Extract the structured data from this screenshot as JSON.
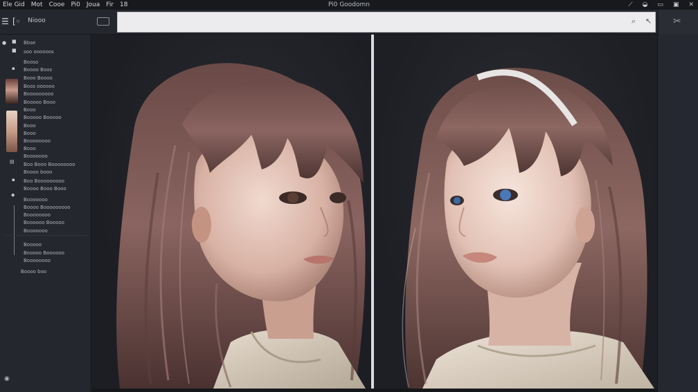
{
  "menubar": {
    "menus": [
      "Ele Gid",
      "Mot",
      "Cooe",
      "Pi0",
      "Joua",
      "Fir",
      "18"
    ],
    "title": "Pi0 Goodomn",
    "window_icons": [
      "pin-icon",
      "eye-icon",
      "window-icon",
      "window-icon",
      "close-icon"
    ]
  },
  "toolbar": {
    "label": "Niooo",
    "search": {
      "value": "",
      "placeholder": ""
    },
    "icons": [
      "menu-icon",
      "code-icon",
      "search-icon",
      "arrow-icon",
      "tools-icon"
    ]
  },
  "leftpanel": {
    "items": [
      "Bbse",
      "soo oooooos",
      "Booso",
      "Boooo Boos",
      "Booo Boooo",
      "Boos oooooo",
      "Booooooooo",
      "Booooo Booo",
      "Booo",
      "Booooo Booooo",
      "Booo",
      "Booo",
      "Boooooooo",
      "Booo",
      "Booooooo",
      "Boo Booo Boooooooo",
      "Boooo booo",
      "Boo Booooooooo",
      "Boooo Booo Booo",
      "Booooooo",
      "Boooo Booooooooo",
      "Boooooooo",
      "Boooooo Booooo",
      "Booooooo",
      "Booooo",
      "Booooo Boooooo",
      "Boooooooo",
      "Boooo boo"
    ]
  },
  "colors": {
    "background": "#1f2228",
    "panel": "#24272d",
    "accent": "#d9dbe0"
  }
}
